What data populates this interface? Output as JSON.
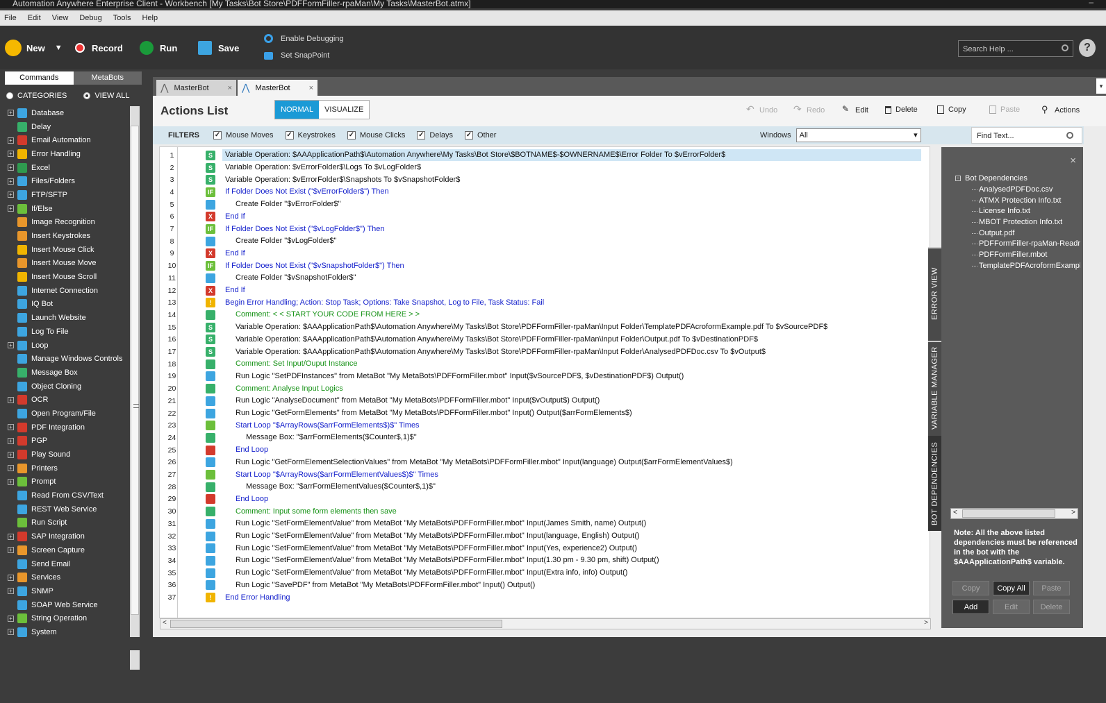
{
  "window": {
    "title": "Automation Anywhere Enterprise Client - Workbench [My Tasks\\Bot Store\\PDFFormFiller-rpaMan\\My Tasks\\MasterBot.atmx]",
    "controls": "–"
  },
  "menu": [
    "File",
    "Edit",
    "View",
    "Debug",
    "Tools",
    "Help"
  ],
  "toolbar": {
    "new": "New",
    "new_dropdown": "▼",
    "record": "Record",
    "run": "Run",
    "save": "Save",
    "enable_debugging": "Enable Debugging",
    "set_snappoint": "Set SnapPoint",
    "search_placeholder": "Search Help ...",
    "help": "?"
  },
  "left": {
    "tabs": [
      "Commands",
      "MetaBots"
    ],
    "radio_categories": "CATEGORIES",
    "radio_view_all": "VIEW ALL",
    "categories": [
      {
        "label": "Database",
        "exp": true,
        "color": "#3da5e0"
      },
      {
        "label": "Delay",
        "exp": false,
        "color": "#37b06a"
      },
      {
        "label": "Email Automation",
        "exp": true,
        "color": "#d33a2c"
      },
      {
        "label": "Error Handling",
        "exp": true,
        "color": "#f0b400"
      },
      {
        "label": "Excel",
        "exp": true,
        "color": "#2f9a4f"
      },
      {
        "label": "Files/Folders",
        "exp": true,
        "color": "#3da5e0"
      },
      {
        "label": "FTP/SFTP",
        "exp": true,
        "color": "#3da5e0"
      },
      {
        "label": "If/Else",
        "exp": true,
        "color": "#6cbf3b"
      },
      {
        "label": "Image Recognition",
        "exp": false,
        "color": "#e8962b"
      },
      {
        "label": "Insert Keystrokes",
        "exp": false,
        "color": "#e8962b"
      },
      {
        "label": "Insert Mouse Click",
        "exp": false,
        "color": "#f0b400"
      },
      {
        "label": "Insert Mouse Move",
        "exp": false,
        "color": "#e8962b"
      },
      {
        "label": "Insert Mouse Scroll",
        "exp": false,
        "color": "#f0b400"
      },
      {
        "label": "Internet Connection",
        "exp": false,
        "color": "#3da5e0"
      },
      {
        "label": "IQ Bot",
        "exp": false,
        "color": "#3da5e0"
      },
      {
        "label": "Launch Website",
        "exp": false,
        "color": "#3da5e0"
      },
      {
        "label": "Log To File",
        "exp": false,
        "color": "#3da5e0"
      },
      {
        "label": "Loop",
        "exp": true,
        "color": "#3da5e0"
      },
      {
        "label": "Manage Windows Controls",
        "exp": false,
        "color": "#3da5e0"
      },
      {
        "label": "Message Box",
        "exp": false,
        "color": "#37b06a"
      },
      {
        "label": "Object Cloning",
        "exp": false,
        "color": "#3da5e0"
      },
      {
        "label": "OCR",
        "exp": true,
        "color": "#d33a2c"
      },
      {
        "label": "Open Program/File",
        "exp": false,
        "color": "#3da5e0"
      },
      {
        "label": "PDF Integration",
        "exp": true,
        "color": "#d33a2c"
      },
      {
        "label": "PGP",
        "exp": true,
        "color": "#d33a2c"
      },
      {
        "label": "Play Sound",
        "exp": true,
        "color": "#d33a2c"
      },
      {
        "label": "Printers",
        "exp": true,
        "color": "#e8962b"
      },
      {
        "label": "Prompt",
        "exp": true,
        "color": "#6cbf3b"
      },
      {
        "label": "Read From CSV/Text",
        "exp": false,
        "color": "#3da5e0"
      },
      {
        "label": "REST Web Service",
        "exp": false,
        "color": "#3da5e0"
      },
      {
        "label": "Run Script",
        "exp": false,
        "color": "#6cbf3b"
      },
      {
        "label": "SAP Integration",
        "exp": true,
        "color": "#d33a2c"
      },
      {
        "label": "Screen Capture",
        "exp": true,
        "color": "#e8962b"
      },
      {
        "label": "Send Email",
        "exp": false,
        "color": "#3da5e0"
      },
      {
        "label": "Services",
        "exp": true,
        "color": "#e8962b"
      },
      {
        "label": "SNMP",
        "exp": true,
        "color": "#3da5e0"
      },
      {
        "label": "SOAP Web Service",
        "exp": false,
        "color": "#3da5e0"
      },
      {
        "label": "String Operation",
        "exp": true,
        "color": "#6cbf3b"
      },
      {
        "label": "System",
        "exp": true,
        "color": "#3da5e0"
      }
    ]
  },
  "tabs": [
    {
      "label": "MasterBot",
      "close": "×"
    },
    {
      "label": "MasterBot",
      "close": "×"
    }
  ],
  "tabmenu": "▾",
  "actions": {
    "title": "Actions List",
    "normal": "NORMAL",
    "visualize": "VISUALIZE",
    "undo": "Undo",
    "redo": "Redo",
    "edit": "Edit",
    "delete": "Delete",
    "copy": "Copy",
    "paste": "Paste",
    "actions": "Actions"
  },
  "filters": {
    "label": "FILTERS",
    "items": [
      "Mouse Moves",
      "Keystrokes",
      "Mouse Clicks",
      "Delays",
      "Other"
    ],
    "check": "✓",
    "windows_label": "Windows",
    "windows_value": "All",
    "find_placeholder": "Find Text..."
  },
  "rows": [
    {
      "n": "1",
      "icon": "S",
      "ic": "#37b06a",
      "c": "black",
      "i": 0,
      "t": "Variable Operation: $AAApplicationPath$\\Automation Anywhere\\My Tasks\\Bot Store\\$BOTNAME$-$OWNERNAME$\\Error Folder To $vErrorFolder$",
      "sel": true
    },
    {
      "n": "2",
      "icon": "S",
      "ic": "#37b06a",
      "c": "black",
      "i": 0,
      "t": "Variable Operation: $vErrorFolder$\\Logs To $vLogFolder$"
    },
    {
      "n": "3",
      "icon": "S",
      "ic": "#37b06a",
      "c": "black",
      "i": 0,
      "t": "Variable Operation: $vErrorFolder$\\Snapshots To $vSnapshotFolder$"
    },
    {
      "n": "4",
      "icon": "IF",
      "ic": "#6cbf3b",
      "c": "blue",
      "i": 0,
      "t": "If Folder Does Not Exist (\"$vErrorFolder$\")  Then"
    },
    {
      "n": "5",
      "icon": "",
      "ic": "#3da5e0",
      "c": "black",
      "i": 1,
      "t": "Create Folder \"$vErrorFolder$\""
    },
    {
      "n": "6",
      "icon": "X",
      "ic": "#d33a2c",
      "c": "blue",
      "i": 0,
      "t": "End If"
    },
    {
      "n": "7",
      "icon": "IF",
      "ic": "#6cbf3b",
      "c": "blue",
      "i": 0,
      "t": "If Folder Does Not Exist (\"$vLogFolder$\")  Then"
    },
    {
      "n": "8",
      "icon": "",
      "ic": "#3da5e0",
      "c": "black",
      "i": 1,
      "t": "Create Folder \"$vLogFolder$\""
    },
    {
      "n": "9",
      "icon": "X",
      "ic": "#d33a2c",
      "c": "blue",
      "i": 0,
      "t": "End If"
    },
    {
      "n": "10",
      "icon": "IF",
      "ic": "#6cbf3b",
      "c": "blue",
      "i": 0,
      "t": "If Folder Does Not Exist (\"$vSnapshotFolder$\")  Then"
    },
    {
      "n": "11",
      "icon": "",
      "ic": "#3da5e0",
      "c": "black",
      "i": 1,
      "t": "Create Folder \"$vSnapshotFolder$\""
    },
    {
      "n": "12",
      "icon": "X",
      "ic": "#d33a2c",
      "c": "blue",
      "i": 0,
      "t": "End If"
    },
    {
      "n": "13",
      "icon": "!",
      "ic": "#f0b400",
      "c": "blue",
      "i": 0,
      "t": "Begin Error Handling; Action: Stop Task; Options: Take Snapshot, Log to File,  Task Status: Fail"
    },
    {
      "n": "14",
      "icon": "",
      "ic": "#37b06a",
      "c": "green",
      "i": 1,
      "t": "Comment: < < START YOUR CODE FROM HERE > >"
    },
    {
      "n": "15",
      "icon": "S",
      "ic": "#37b06a",
      "c": "black",
      "i": 1,
      "t": "Variable Operation: $AAApplicationPath$\\Automation Anywhere\\My Tasks\\Bot Store\\PDFFormFiller-rpaMan\\Input Folder\\TemplatePDFAcroformExample.pdf To $vSourcePDF$"
    },
    {
      "n": "16",
      "icon": "S",
      "ic": "#37b06a",
      "c": "black",
      "i": 1,
      "t": "Variable Operation: $AAApplicationPath$\\Automation Anywhere\\My Tasks\\Bot Store\\PDFFormFiller-rpaMan\\Input Folder\\Output.pdf To $vDestinationPDF$"
    },
    {
      "n": "17",
      "icon": "S",
      "ic": "#37b06a",
      "c": "black",
      "i": 1,
      "t": "Variable Operation: $AAApplicationPath$\\Automation Anywhere\\My Tasks\\Bot Store\\PDFFormFiller-rpaMan\\Input Folder\\AnalysedPDFDoc.csv To $vOutput$"
    },
    {
      "n": "18",
      "icon": "",
      "ic": "#37b06a",
      "c": "green",
      "i": 1,
      "t": "Comment: Set Input/Ouput Instance"
    },
    {
      "n": "19",
      "icon": "",
      "ic": "#3da5e0",
      "c": "black",
      "i": 1,
      "t": "Run Logic \"SetPDFInstances\" from MetaBot \"My MetaBots\\PDFFormFiller.mbot\" Input($vSourcePDF$, $vDestinationPDF$) Output()"
    },
    {
      "n": "20",
      "icon": "",
      "ic": "#37b06a",
      "c": "green",
      "i": 1,
      "t": "Comment: Analyse Input Logics"
    },
    {
      "n": "21",
      "icon": "",
      "ic": "#3da5e0",
      "c": "black",
      "i": 1,
      "t": "Run Logic \"AnalyseDocument\" from MetaBot \"My MetaBots\\PDFFormFiller.mbot\" Input($vOutput$) Output()"
    },
    {
      "n": "22",
      "icon": "",
      "ic": "#3da5e0",
      "c": "black",
      "i": 1,
      "t": "Run Logic \"GetFormElements\" from MetaBot \"My MetaBots\\PDFFormFiller.mbot\" Input() Output($arrFormElements$)"
    },
    {
      "n": "23",
      "icon": "",
      "ic": "#6cbf3b",
      "c": "blue",
      "i": 1,
      "t": "Start Loop \"$ArrayRows($arrFormElements$)$\" Times"
    },
    {
      "n": "24",
      "icon": "",
      "ic": "#37b06a",
      "c": "black",
      "i": 2,
      "t": "Message Box: \"$arrFormElements($Counter$,1)$\""
    },
    {
      "n": "25",
      "icon": "",
      "ic": "#d33a2c",
      "c": "blue",
      "i": 1,
      "t": "End Loop"
    },
    {
      "n": "26",
      "icon": "",
      "ic": "#3da5e0",
      "c": "black",
      "i": 1,
      "t": "Run Logic \"GetFormElementSelectionValues\" from MetaBot \"My MetaBots\\PDFFormFiller.mbot\" Input(language) Output($arrFormElementValues$)"
    },
    {
      "n": "27",
      "icon": "",
      "ic": "#6cbf3b",
      "c": "blue",
      "i": 1,
      "t": "Start Loop \"$ArrayRows($arrFormElementValues$)$\" Times"
    },
    {
      "n": "28",
      "icon": "",
      "ic": "#37b06a",
      "c": "black",
      "i": 2,
      "t": "Message Box: \"$arrFormElementValues($Counter$,1)$\""
    },
    {
      "n": "29",
      "icon": "",
      "ic": "#d33a2c",
      "c": "blue",
      "i": 1,
      "t": "End Loop"
    },
    {
      "n": "30",
      "icon": "",
      "ic": "#37b06a",
      "c": "green",
      "i": 1,
      "t": "Comment: Input some form elements then save"
    },
    {
      "n": "31",
      "icon": "",
      "ic": "#3da5e0",
      "c": "black",
      "i": 1,
      "t": "Run Logic \"SetFormElementValue\" from MetaBot \"My MetaBots\\PDFFormFiller.mbot\" Input(James Smith, name) Output()"
    },
    {
      "n": "32",
      "icon": "",
      "ic": "#3da5e0",
      "c": "black",
      "i": 1,
      "t": "Run Logic \"SetFormElementValue\" from MetaBot \"My MetaBots\\PDFFormFiller.mbot\" Input(language, English) Output()"
    },
    {
      "n": "33",
      "icon": "",
      "ic": "#3da5e0",
      "c": "black",
      "i": 1,
      "t": "Run Logic \"SetFormElementValue\" from MetaBot \"My MetaBots\\PDFFormFiller.mbot\" Input(Yes, experience2) Output()"
    },
    {
      "n": "34",
      "icon": "",
      "ic": "#3da5e0",
      "c": "black",
      "i": 1,
      "t": "Run Logic \"SetFormElementValue\" from MetaBot \"My MetaBots\\PDFFormFiller.mbot\" Input(1.30 pm - 9.30 pm, shift) Output()"
    },
    {
      "n": "35",
      "icon": "",
      "ic": "#3da5e0",
      "c": "black",
      "i": 1,
      "t": "Run Logic \"SetFormElementValue\" from MetaBot \"My MetaBots\\PDFFormFiller.mbot\" Input(Extra info, info) Output()"
    },
    {
      "n": "36",
      "icon": "",
      "ic": "#3da5e0",
      "c": "black",
      "i": 1,
      "t": "Run Logic \"SavePDF\" from MetaBot \"My MetaBots\\PDFFormFiller.mbot\" Input() Output()"
    },
    {
      "n": "37",
      "icon": "!",
      "ic": "#f0b400",
      "c": "blue",
      "i": 0,
      "t": "End Error Handling"
    }
  ],
  "sidetabs": [
    "ERROR VIEW",
    "VARIABLE MANAGER",
    "BOT DEPENDENCIES"
  ],
  "deps": {
    "close": "×",
    "root": "Bot Dependencies",
    "items": [
      "AnalysedPDFDoc.csv",
      "ATMX Protection Info.txt",
      "License Info.txt",
      "MBOT Protection Info.txt",
      "Output.pdf",
      "PDFFormFiller-rpaMan-Readme",
      "PDFFormFiller.mbot",
      "TemplatePDFAcroformExample"
    ],
    "note": "Note: All the above listed dependencies must be referenced in the bot with the $AAApplicationPath$ variable.",
    "buttons": {
      "copy": "Copy",
      "copy_all": "Copy All",
      "paste": "Paste",
      "add": "Add",
      "edit": "Edit",
      "delete": "Delete"
    }
  }
}
